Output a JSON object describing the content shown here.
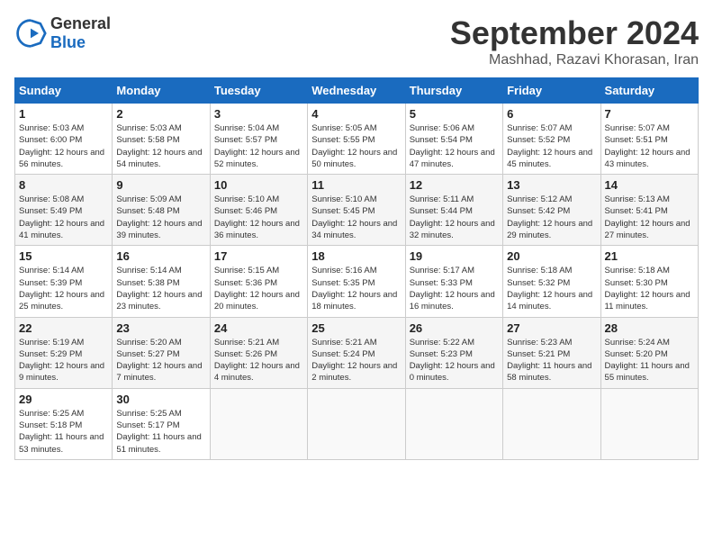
{
  "header": {
    "logo_general": "General",
    "logo_blue": "Blue",
    "title": "September 2024",
    "subtitle": "Mashhad, Razavi Khorasan, Iran"
  },
  "weekdays": [
    "Sunday",
    "Monday",
    "Tuesday",
    "Wednesday",
    "Thursday",
    "Friday",
    "Saturday"
  ],
  "weeks": [
    [
      {
        "day": "1",
        "sunrise": "5:03 AM",
        "sunset": "6:00 PM",
        "daylight": "12 hours and 56 minutes."
      },
      {
        "day": "2",
        "sunrise": "5:03 AM",
        "sunset": "5:58 PM",
        "daylight": "12 hours and 54 minutes."
      },
      {
        "day": "3",
        "sunrise": "5:04 AM",
        "sunset": "5:57 PM",
        "daylight": "12 hours and 52 minutes."
      },
      {
        "day": "4",
        "sunrise": "5:05 AM",
        "sunset": "5:55 PM",
        "daylight": "12 hours and 50 minutes."
      },
      {
        "day": "5",
        "sunrise": "5:06 AM",
        "sunset": "5:54 PM",
        "daylight": "12 hours and 47 minutes."
      },
      {
        "day": "6",
        "sunrise": "5:07 AM",
        "sunset": "5:52 PM",
        "daylight": "12 hours and 45 minutes."
      },
      {
        "day": "7",
        "sunrise": "5:07 AM",
        "sunset": "5:51 PM",
        "daylight": "12 hours and 43 minutes."
      }
    ],
    [
      {
        "day": "8",
        "sunrise": "5:08 AM",
        "sunset": "5:49 PM",
        "daylight": "12 hours and 41 minutes."
      },
      {
        "day": "9",
        "sunrise": "5:09 AM",
        "sunset": "5:48 PM",
        "daylight": "12 hours and 39 minutes."
      },
      {
        "day": "10",
        "sunrise": "5:10 AM",
        "sunset": "5:46 PM",
        "daylight": "12 hours and 36 minutes."
      },
      {
        "day": "11",
        "sunrise": "5:10 AM",
        "sunset": "5:45 PM",
        "daylight": "12 hours and 34 minutes."
      },
      {
        "day": "12",
        "sunrise": "5:11 AM",
        "sunset": "5:44 PM",
        "daylight": "12 hours and 32 minutes."
      },
      {
        "day": "13",
        "sunrise": "5:12 AM",
        "sunset": "5:42 PM",
        "daylight": "12 hours and 29 minutes."
      },
      {
        "day": "14",
        "sunrise": "5:13 AM",
        "sunset": "5:41 PM",
        "daylight": "12 hours and 27 minutes."
      }
    ],
    [
      {
        "day": "15",
        "sunrise": "5:14 AM",
        "sunset": "5:39 PM",
        "daylight": "12 hours and 25 minutes."
      },
      {
        "day": "16",
        "sunrise": "5:14 AM",
        "sunset": "5:38 PM",
        "daylight": "12 hours and 23 minutes."
      },
      {
        "day": "17",
        "sunrise": "5:15 AM",
        "sunset": "5:36 PM",
        "daylight": "12 hours and 20 minutes."
      },
      {
        "day": "18",
        "sunrise": "5:16 AM",
        "sunset": "5:35 PM",
        "daylight": "12 hours and 18 minutes."
      },
      {
        "day": "19",
        "sunrise": "5:17 AM",
        "sunset": "5:33 PM",
        "daylight": "12 hours and 16 minutes."
      },
      {
        "day": "20",
        "sunrise": "5:18 AM",
        "sunset": "5:32 PM",
        "daylight": "12 hours and 14 minutes."
      },
      {
        "day": "21",
        "sunrise": "5:18 AM",
        "sunset": "5:30 PM",
        "daylight": "12 hours and 11 minutes."
      }
    ],
    [
      {
        "day": "22",
        "sunrise": "5:19 AM",
        "sunset": "5:29 PM",
        "daylight": "12 hours and 9 minutes."
      },
      {
        "day": "23",
        "sunrise": "5:20 AM",
        "sunset": "5:27 PM",
        "daylight": "12 hours and 7 minutes."
      },
      {
        "day": "24",
        "sunrise": "5:21 AM",
        "sunset": "5:26 PM",
        "daylight": "12 hours and 4 minutes."
      },
      {
        "day": "25",
        "sunrise": "5:21 AM",
        "sunset": "5:24 PM",
        "daylight": "12 hours and 2 minutes."
      },
      {
        "day": "26",
        "sunrise": "5:22 AM",
        "sunset": "5:23 PM",
        "daylight": "12 hours and 0 minutes."
      },
      {
        "day": "27",
        "sunrise": "5:23 AM",
        "sunset": "5:21 PM",
        "daylight": "11 hours and 58 minutes."
      },
      {
        "day": "28",
        "sunrise": "5:24 AM",
        "sunset": "5:20 PM",
        "daylight": "11 hours and 55 minutes."
      }
    ],
    [
      {
        "day": "29",
        "sunrise": "5:25 AM",
        "sunset": "5:18 PM",
        "daylight": "11 hours and 53 minutes."
      },
      {
        "day": "30",
        "sunrise": "5:25 AM",
        "sunset": "5:17 PM",
        "daylight": "11 hours and 51 minutes."
      },
      null,
      null,
      null,
      null,
      null
    ]
  ]
}
